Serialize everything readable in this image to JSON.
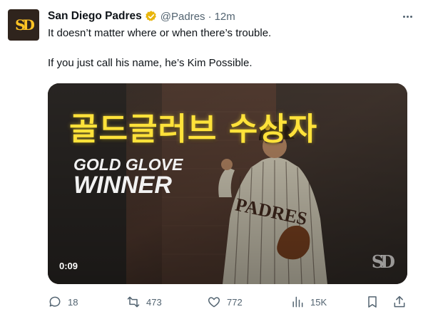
{
  "tweet": {
    "author": {
      "display_name": "San Diego Padres",
      "handle": "@Padres",
      "separator": "·",
      "time": "12m",
      "verified_color": "#e8b50c"
    },
    "text_lines": [
      "It doesn’t matter where or when there’s trouble.",
      "If you just call his name, he’s Kim Possible."
    ],
    "media": {
      "title_korean": "골드글러브 수상자",
      "title_en_line1": "GOLD GLOVE",
      "title_en_line2": "WINNER",
      "duration": "0:09",
      "title_color": "#ffe23a"
    },
    "actions": {
      "reply_count": "18",
      "repost_count": "473",
      "like_count": "772",
      "views_count": "15K"
    }
  }
}
